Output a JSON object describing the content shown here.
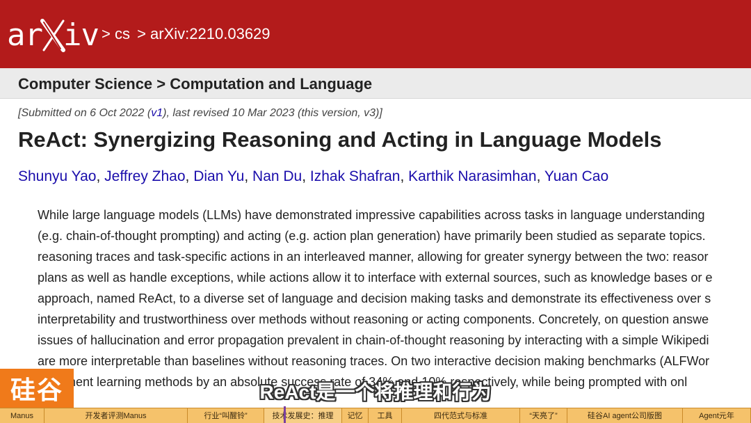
{
  "header": {
    "logo_left": "ar",
    "logo_right": "iv",
    "breadcrumbs": [
      "> cs",
      "> arXiv:2210.03629"
    ]
  },
  "subject": "Computer Science > Computation and Language",
  "paper": {
    "dateline_prefix": "[Submitted on 6 Oct 2022 (",
    "dateline_link": "v1",
    "dateline_suffix": "), last revised 10 Mar 2023 (this version, v3)]",
    "title": "ReAct: Synergizing Reasoning and Acting in Language Models",
    "authors": [
      "Shunyu Yao",
      "Jeffrey Zhao",
      "Dian Yu",
      "Nan Du",
      "Izhak Shafran",
      "Karthik Narasimhan",
      "Yuan Cao"
    ],
    "abstract_lines": [
      "While large language models (LLMs) have demonstrated impressive capabilities across tasks in language understanding",
      "(e.g. chain-of-thought prompting) and acting (e.g. action plan generation) have primarily been studied as separate topics.",
      "reasoning traces and task-specific actions in an interleaved manner, allowing for greater synergy between the two: reasor",
      "plans as well as handle exceptions, while actions allow it to interface with external sources, such as knowledge bases or e",
      "approach, named ReAct, to a diverse set of language and decision making tasks and demonstrate its effectiveness over s",
      "interpretability and trustworthiness over methods without reasoning or acting components. Concretely, on question answe",
      "issues of hallucination and error propagation prevalent in chain-of-thought reasoning by interacting with a simple Wikipedi",
      "are more interpretable than baselines without reasoning traces. On two interactive decision making benchmarks (ALFWor",
      "forcement learning methods by an absolute success rate of 34% and 10% respectively, while being prompted with onl"
    ],
    "abstract_link": "URL"
  },
  "overlay": {
    "brand": "硅谷",
    "subtitle": "ReAct是一个将推理和行为"
  },
  "chapters": [
    {
      "label": "Manus",
      "width": 64
    },
    {
      "label": "开发者评测Manus",
      "width": 206
    },
    {
      "label": "行业“叫醒铃”",
      "width": 110
    },
    {
      "label": "技术发展史：推理",
      "width": 112
    },
    {
      "label": "记忆",
      "width": 38
    },
    {
      "label": "工具",
      "width": 48
    },
    {
      "label": "四代范式与标准",
      "width": 170
    },
    {
      "label": "“天亮了”",
      "width": 68
    },
    {
      "label": "硅谷AI agent公司版图",
      "width": 166
    },
    {
      "label": "Agent元年",
      "width": 98
    }
  ],
  "colors": {
    "header_red": "#b31b1b",
    "link_blue": "#1a0dab",
    "brand_orange": "#f07a1a",
    "chapter_bar": "#f5c26b"
  }
}
